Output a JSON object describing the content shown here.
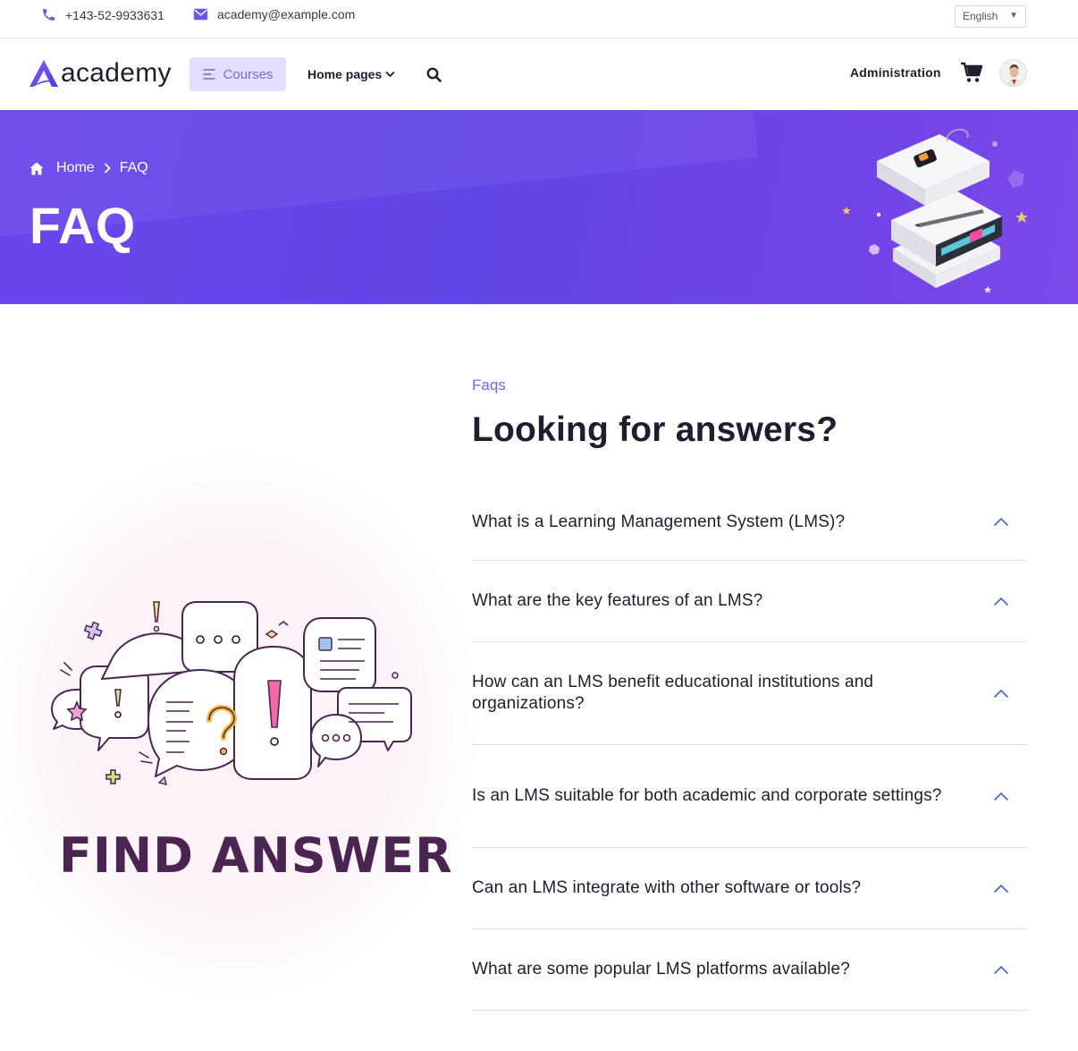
{
  "topbar": {
    "phone": "+143-52-9933631",
    "email": "academy@example.com",
    "language": "English"
  },
  "header": {
    "logo_text": "academy",
    "courses_label": "Courses",
    "home_pages_label": "Home pages",
    "admin_label": "Administration"
  },
  "banner": {
    "breadcrumb_home": "Home",
    "breadcrumb_current": "FAQ",
    "title": "FAQ"
  },
  "illustration": {
    "caption": "FIND ANSWER"
  },
  "faq": {
    "kicker": "Faqs",
    "title": "Looking for answers?",
    "items": [
      {
        "question": "What is a Learning Management System (LMS)?"
      },
      {
        "question": "What are the key features of an LMS?"
      },
      {
        "question": "How can an LMS benefit educational institutions and organizations?"
      },
      {
        "question": "Is an LMS suitable for both academic and corporate settings?"
      },
      {
        "question": "Can an LMS integrate with other software or tools?"
      },
      {
        "question": "What are some popular LMS platforms available?"
      }
    ]
  },
  "colors": {
    "accent": "#6a46ea",
    "kicker": "#7b5ee8",
    "chevron": "#4a6ad8",
    "illustration_text": "#4b2552"
  },
  "icons": [
    "phone-icon",
    "mail-icon",
    "menu-lines-icon",
    "chevron-down-icon",
    "search-icon",
    "cart-icon",
    "home-icon",
    "chevron-right-icon",
    "chevron-up-icon"
  ]
}
